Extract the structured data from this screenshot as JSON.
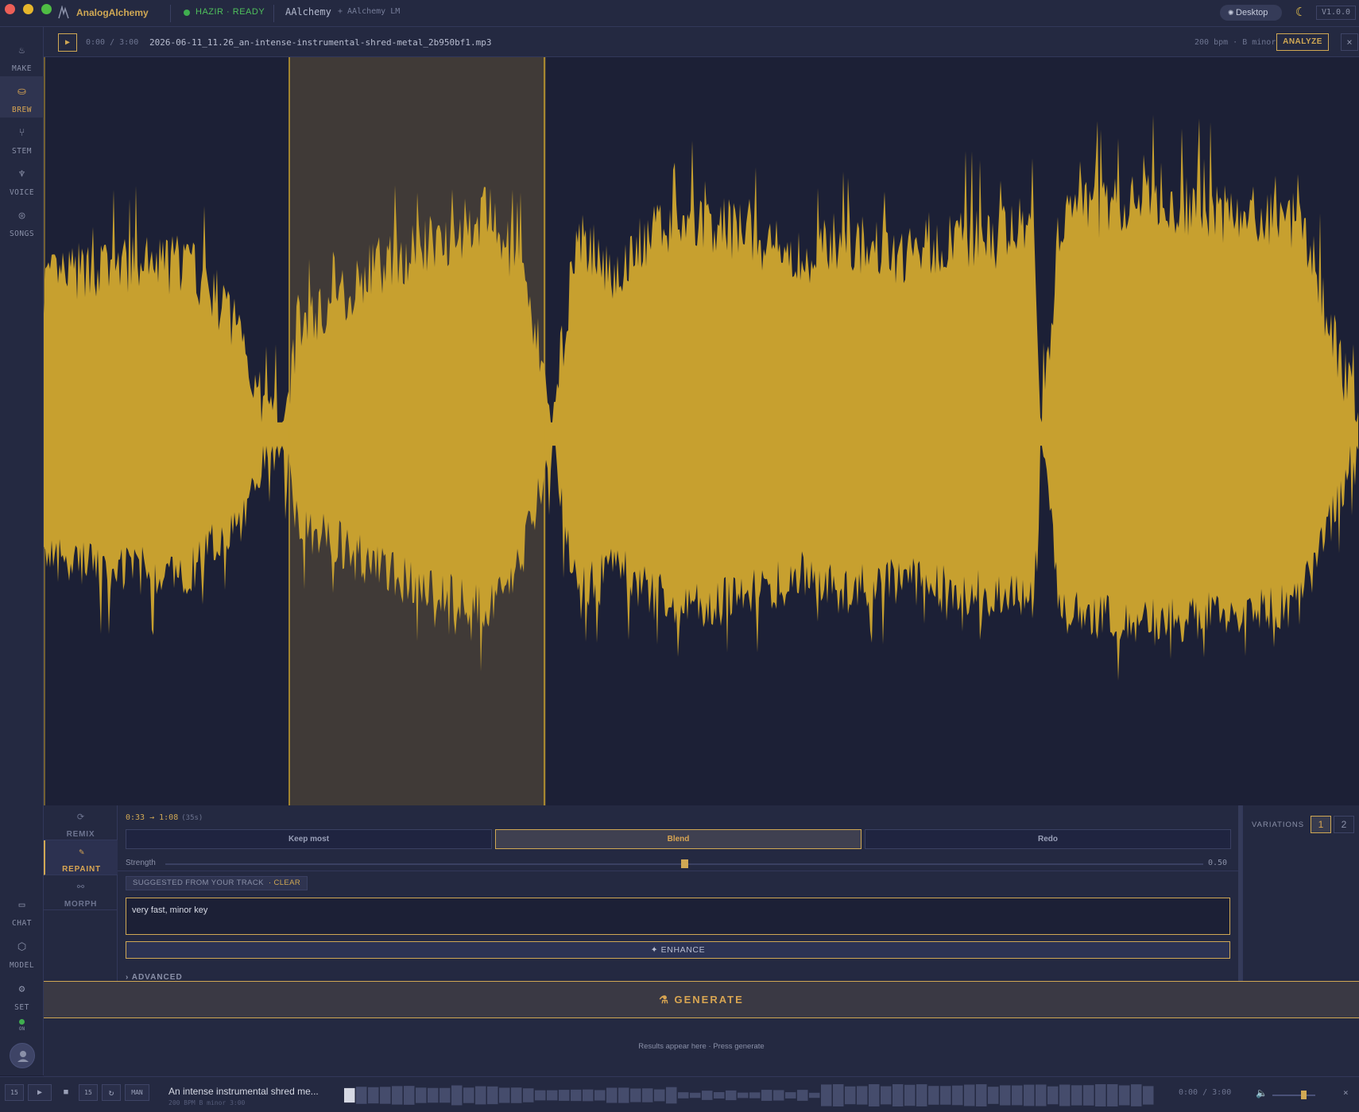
{
  "app": {
    "brand": "AnalogAlchemy",
    "status": "HAZIR · READY",
    "crumb_main": "AAlchemy",
    "crumb_sub": "+ AAlchemy LM",
    "desktop_label": "Desktop",
    "version": "V1.0.0"
  },
  "rail": {
    "items": [
      {
        "label": "MAKE",
        "icon": "flame-icon"
      },
      {
        "label": "BREW",
        "icon": "pot-icon"
      },
      {
        "label": "STEM",
        "icon": "fork-icon"
      },
      {
        "label": "VOICE",
        "icon": "mic-icon"
      },
      {
        "label": "SONGS",
        "icon": "disc-icon"
      }
    ],
    "bottom": [
      {
        "label": "CHAT",
        "icon": "chat-icon"
      },
      {
        "label": "MODEL",
        "icon": "cube-icon"
      },
      {
        "label": "SET",
        "icon": "gear-icon"
      }
    ],
    "on_label": "ON"
  },
  "file": {
    "time": "0:00 / 3:00",
    "name": "2026-06-11_11.26_an-intense-instrumental-shred-metal_2b950bf1.mp3",
    "meta": "200 bpm · B minor",
    "analyze_label": "ANALYZE"
  },
  "waveform": {
    "color": "#c7a02f",
    "selection_start": "0:33",
    "selection_end": "1:08",
    "duration": "3:00"
  },
  "modes": [
    {
      "label": "REMIX",
      "icon": "refresh-icon"
    },
    {
      "label": "REPAINT",
      "icon": "brush-icon"
    },
    {
      "label": "MORPH",
      "icon": "morph-icon"
    }
  ],
  "editor": {
    "range": "0:33 → 1:08",
    "range_duration": "(35s)",
    "options": [
      "Keep most",
      "Blend",
      "Redo"
    ],
    "selected_option": "Blend",
    "strength_label": "Strength",
    "strength_value": "0.50",
    "strength": 0.5,
    "suggested_label": "SUGGESTED FROM YOUR TRACK",
    "clear_label": "· CLEAR",
    "prompt": "very fast, minor key",
    "enhance_label": "✦ ENHANCE",
    "advanced_label": "› ADVANCED"
  },
  "variations": {
    "label": "VARIATIONS",
    "options": [
      "1",
      "2"
    ],
    "selected": "1"
  },
  "generate_label": "⚗ GENERATE",
  "results_text": "Results appear here · Press generate",
  "transport": {
    "back_label": "15",
    "fwd_label": "15",
    "man_label": "MAN",
    "title": "An intense instrumental shred me...",
    "meta": "200 BPM B minor 3:00",
    "time": "0:00 / 3:00",
    "accent": "#d0a854"
  }
}
